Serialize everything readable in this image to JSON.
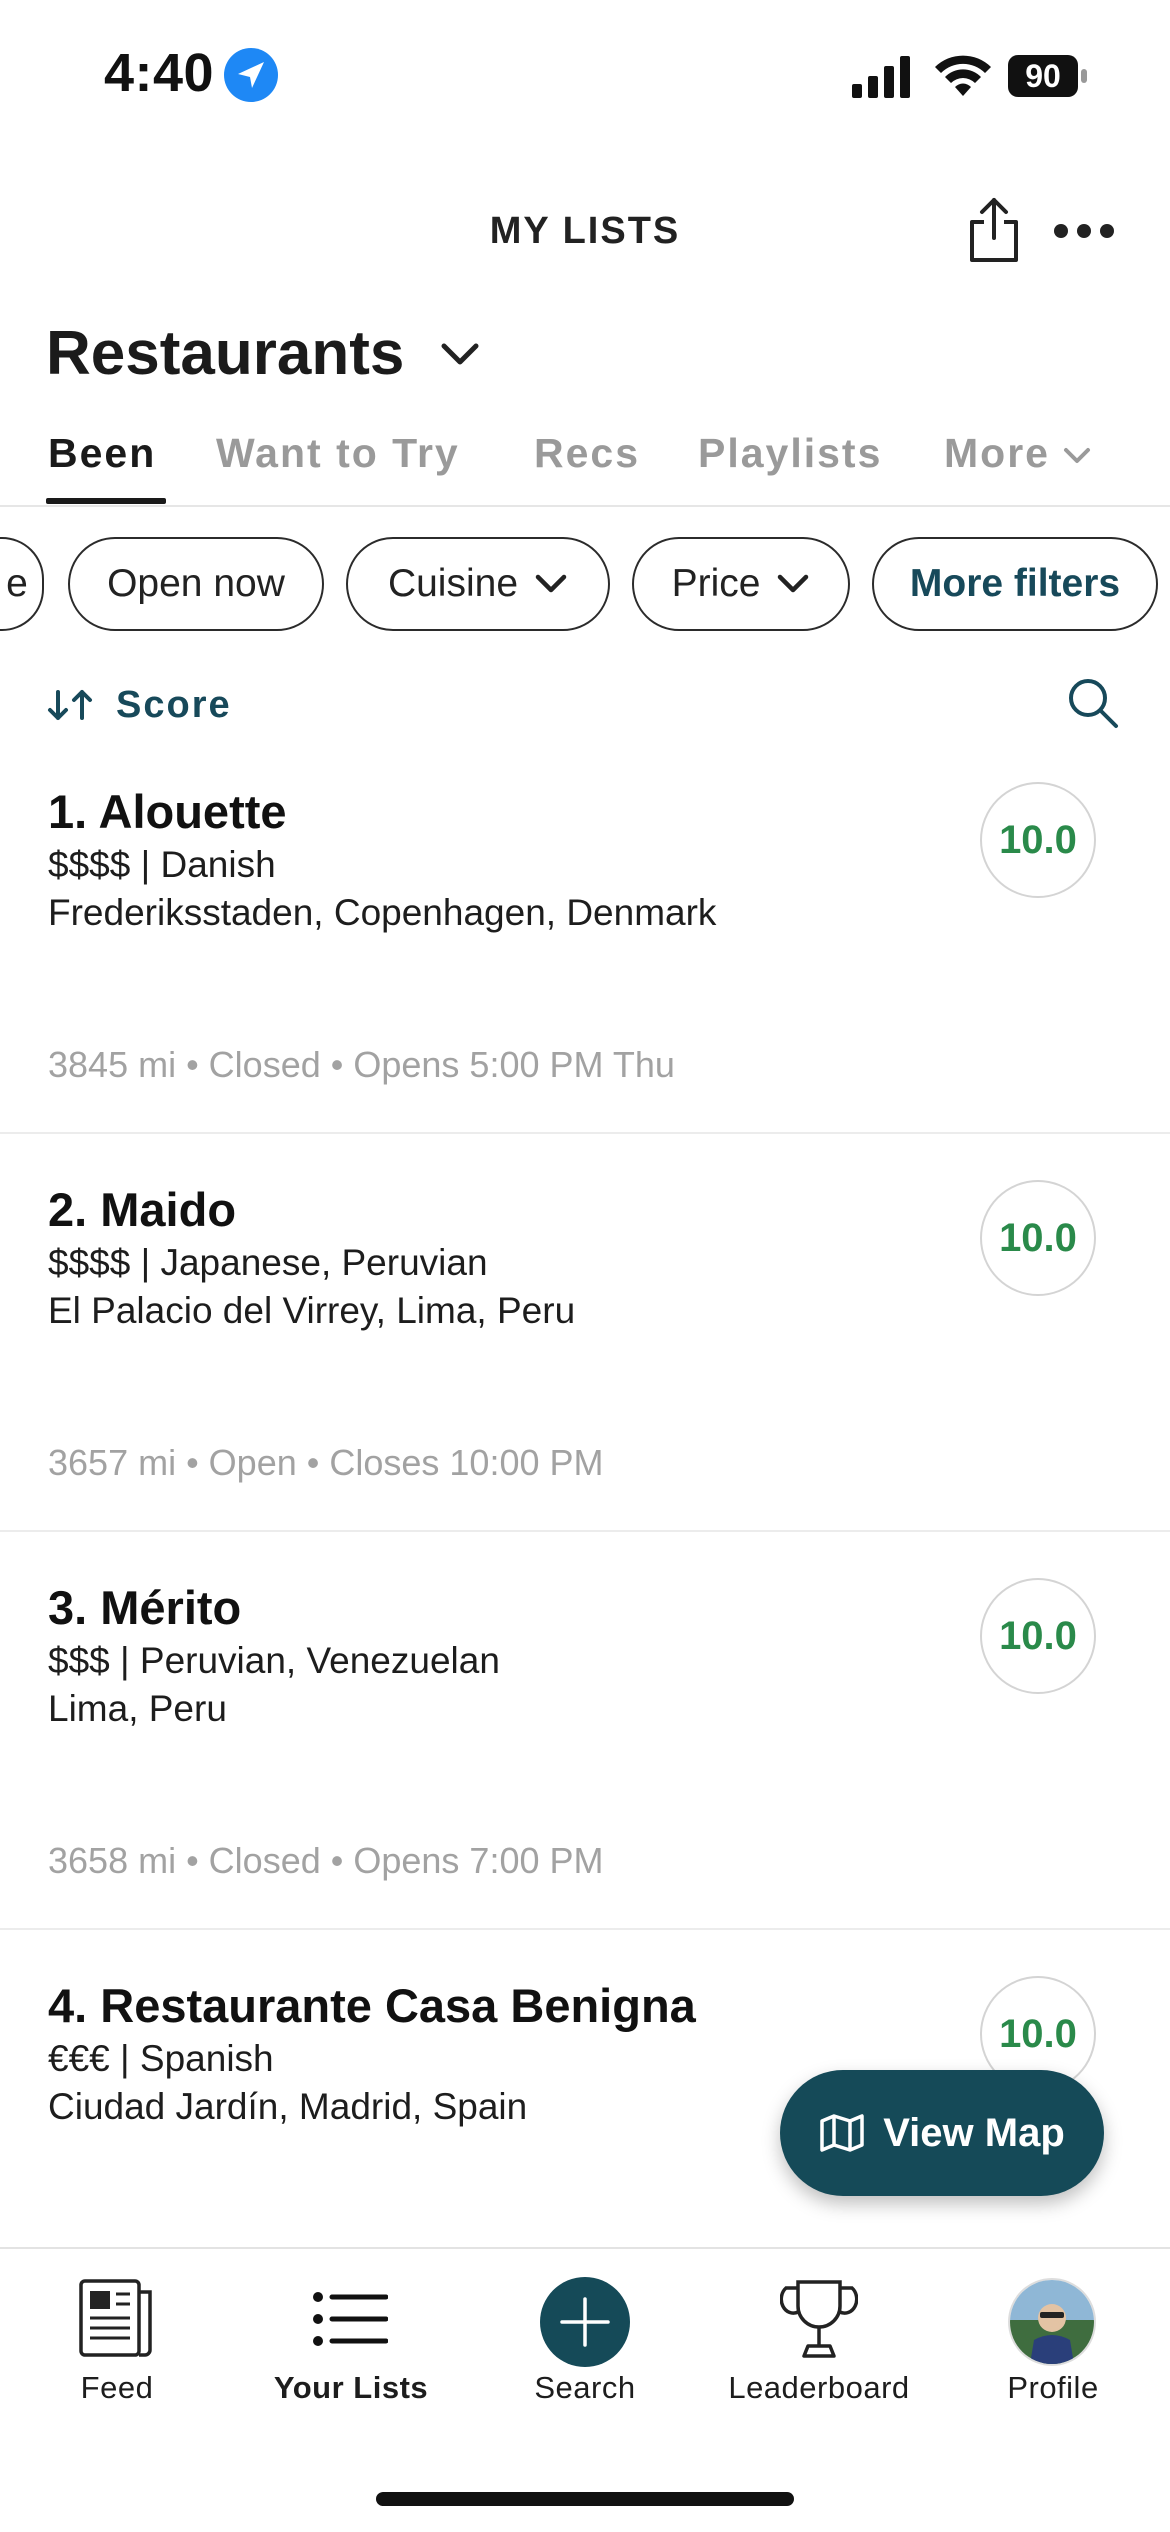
{
  "status_bar": {
    "time": "4:40",
    "battery": "90"
  },
  "header": {
    "title": "MY LISTS",
    "list_title": "Restaurants"
  },
  "tabs": [
    {
      "label": "Been"
    },
    {
      "label": "Want to Try"
    },
    {
      "label": "Recs"
    },
    {
      "label": "Playlists"
    },
    {
      "label": "More"
    }
  ],
  "filters": {
    "partial": "e",
    "open_now": "Open now",
    "cuisine": "Cuisine",
    "price": "Price",
    "more": "More filters"
  },
  "sort": {
    "label": "Score"
  },
  "restaurants": [
    {
      "name": "1. Alouette",
      "meta": "$$$$ | Danish",
      "location": "Frederiksstaden, Copenhagen, Denmark",
      "status": "3845 mi • Closed • Opens 5:00 PM Thu",
      "score": "10.0"
    },
    {
      "name": "2. Maido",
      "meta": "$$$$ | Japanese, Peruvian",
      "location": "El Palacio del Virrey, Lima, Peru",
      "status": "3657 mi • Open • Closes 10:00 PM",
      "score": "10.0"
    },
    {
      "name": "3. Mérito",
      "meta": "$$$ | Peruvian, Venezuelan",
      "location": "Lima, Peru",
      "status": "3658 mi • Closed • Opens 7:00 PM",
      "score": "10.0"
    },
    {
      "name": "4. Restaurante Casa Benigna",
      "meta": "€€€ | Spanish",
      "location": "Ciudad Jardín, Madrid, Spain",
      "status": "",
      "score": "10.0"
    }
  ],
  "view_map": {
    "label": "View Map"
  },
  "bottom_nav": [
    {
      "label": "Feed",
      "icon": "newspaper-icon"
    },
    {
      "label": "Your Lists",
      "icon": "list-icon"
    },
    {
      "label": "Search",
      "icon": "plus-icon"
    },
    {
      "label": "Leaderboard",
      "icon": "trophy-icon"
    },
    {
      "label": "Profile",
      "icon": "avatar"
    }
  ],
  "colors": {
    "accent": "#154a58",
    "score_green": "#2a8a4a",
    "muted": "#9a9a9a"
  }
}
